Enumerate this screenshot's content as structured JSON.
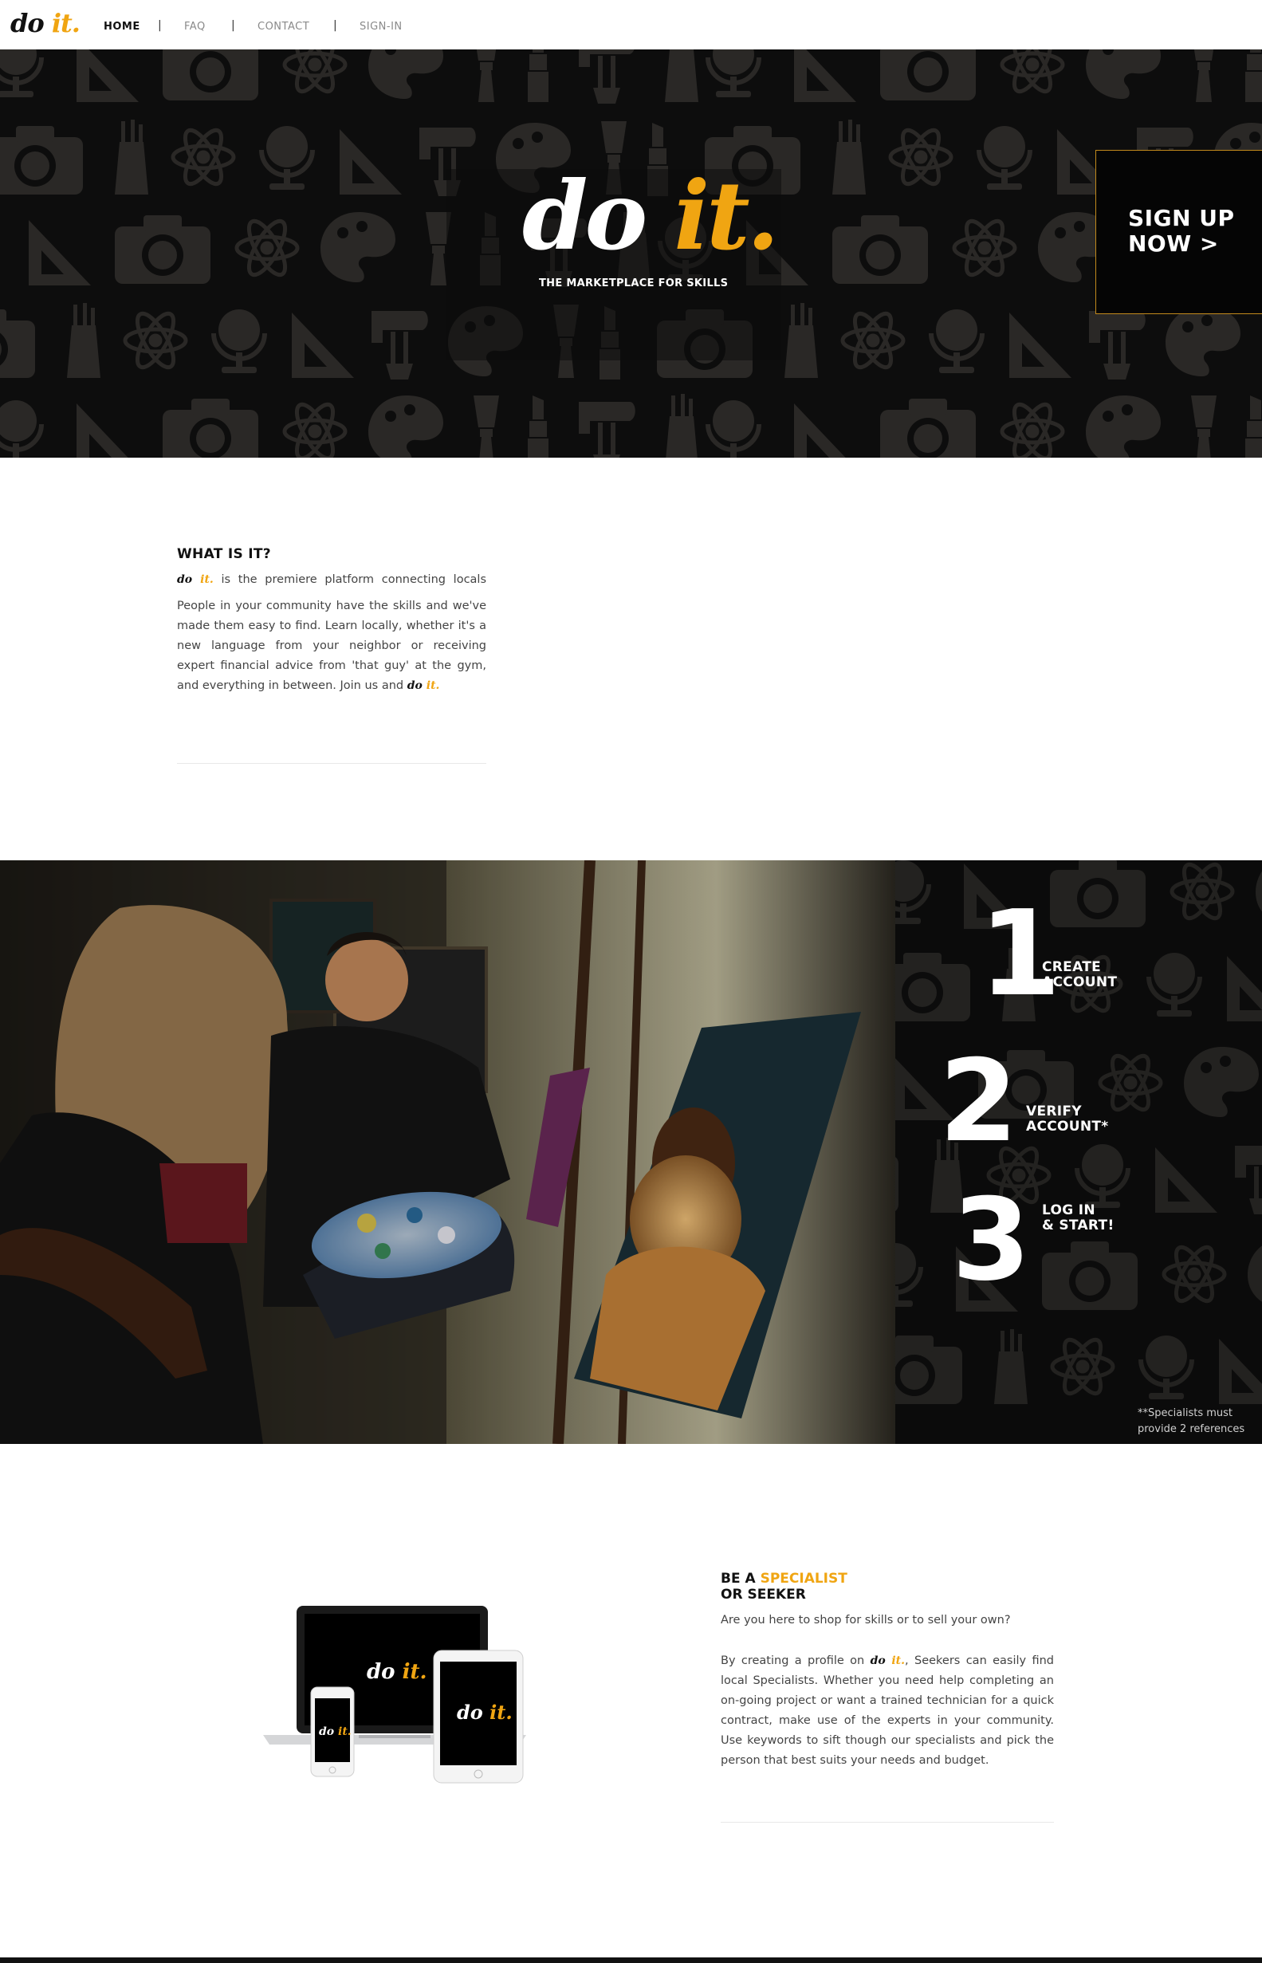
{
  "brand": {
    "do": "do",
    "it": "it."
  },
  "nav": {
    "items": [
      {
        "label": "HOME",
        "color": "#111111"
      },
      {
        "label": "FAQ",
        "color": "#8a8a8a"
      },
      {
        "label": "CONTACT",
        "color": "#8a8a8a"
      },
      {
        "label": "SIGN-IN",
        "color": "#8a8a8a"
      }
    ],
    "separator": "|"
  },
  "hero": {
    "tagline": "THE MARKETPLACE FOR SKILLS",
    "signup_line1": "SIGN UP",
    "signup_line2": "NOW >"
  },
  "what": {
    "title": "WHAT IS IT?",
    "intro_after_logo": "is the premiere platform connecting locals",
    "body": "People in your community have the skills and we've made them easy to find. Learn locally, whether it's a new language from your neighbor or receiving expert financial advice from 'that guy' at the gym, and everything in between. Join us and"
  },
  "steps": [
    {
      "num": "1",
      "line1": "CREATE",
      "line2": "ACCOUNT"
    },
    {
      "num": "2",
      "line1": "VERIFY",
      "line2": "ACCOUNT*"
    },
    {
      "num": "3",
      "line1": "LOG IN",
      "line2": "& START!"
    }
  ],
  "steps_note": {
    "line1": "**Specialists must",
    "line2": "provide 2 references"
  },
  "specialist": {
    "title_prefix": "BE A ",
    "title_highlight": "SPECIALIST",
    "title_line2": "OR SEEKER",
    "question": "Are you here to shop for skills or to sell your own?",
    "body_prefix": "By creating a profile on",
    "body_rest": ", Seekers can easily find local Specialists. Whether you need help completing an on-going project or want a trained technician for a quick contract, make use of the experts in your community. Use keywords to sift though our specialists and pick the person that best suits your needs and budget."
  },
  "colors": {
    "accent": "#f0a512",
    "dark": "#0d0d0d",
    "pattern": "#2a2826"
  },
  "icons": [
    "globe-icon",
    "set-square-icon",
    "camera-icon",
    "atom-icon",
    "palette-icon",
    "mixer-icon",
    "brush-icon",
    "lipstick-icon",
    "golf-bag-icon"
  ]
}
